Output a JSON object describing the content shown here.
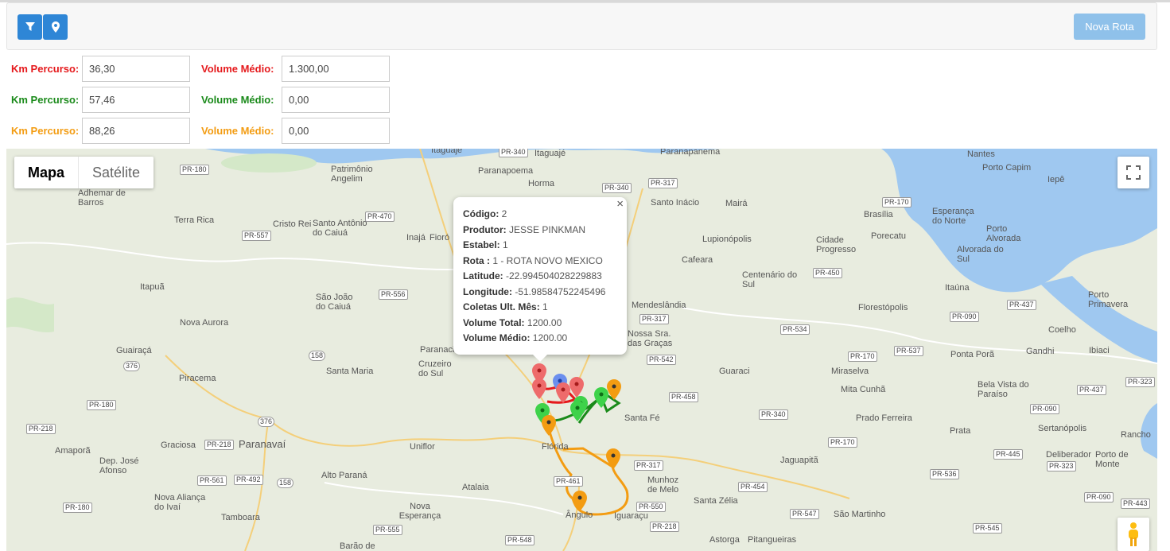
{
  "toolbar": {
    "new_route_label": "Nova Rota"
  },
  "routes": [
    {
      "km_label": "Km Percurso:",
      "km_value": "36,30",
      "vol_label": "Volume Médio:",
      "vol_value": "1.300,00",
      "color": "#e5191c"
    },
    {
      "km_label": "Km Percurso:",
      "km_value": "57,46",
      "vol_label": "Volume Médio:",
      "vol_value": "0,00",
      "color": "#1a8a1a"
    },
    {
      "km_label": "Km Percurso:",
      "km_value": "88,26",
      "vol_label": "Volume Médio:",
      "vol_value": "0,00",
      "color": "#f39c12"
    }
  ],
  "map": {
    "type_map": "Mapa",
    "type_satellite": "Satélite",
    "places": [
      {
        "t": "Itaguajé"
      },
      {
        "t": "Paranapanema"
      },
      {
        "t": "Nantes"
      },
      {
        "t": "Porto Capim"
      },
      {
        "t": "Iepê"
      },
      {
        "t": "Paranapoema"
      },
      {
        "t": "Horma"
      },
      {
        "t": "Santo Inácio"
      },
      {
        "t": "Mairá"
      },
      {
        "t": "Brasília"
      },
      {
        "t": "Esperança do Norte"
      },
      {
        "t": "Porecatu"
      },
      {
        "t": "Lupionópolis"
      },
      {
        "t": "Cidade Progresso"
      },
      {
        "t": "Porto Alvorada"
      },
      {
        "t": "Alvorada do Sul"
      },
      {
        "t": "Patrimônio Angelim"
      },
      {
        "t": "Adhemar de Barros"
      },
      {
        "t": "Terra Rica"
      },
      {
        "t": "Cristo Rei"
      },
      {
        "t": "Santo Antônio do Caiuá"
      },
      {
        "t": "Inajá"
      },
      {
        "t": "Fioró"
      },
      {
        "t": "Cafeara"
      },
      {
        "t": "Centenário do Sul"
      },
      {
        "t": "Itapuã"
      },
      {
        "t": "São João do Caiuá"
      },
      {
        "t": "Mendeslândia"
      },
      {
        "t": "Florestópolis"
      },
      {
        "t": "Itaúna"
      },
      {
        "t": "Porto Primavera"
      },
      {
        "t": "Nova Aurora"
      },
      {
        "t": "Nossa Sra. das Graças"
      },
      {
        "t": "Coelho"
      },
      {
        "t": "Guairaçá"
      },
      {
        "t": "Paranacity"
      },
      {
        "t": "Cruzeiro do Sul"
      },
      {
        "t": "Ponta Porã"
      },
      {
        "t": "Gandhi"
      },
      {
        "t": "Ibiaci"
      },
      {
        "t": "Santa Maria"
      },
      {
        "t": "Guaraci"
      },
      {
        "t": "Miraselva"
      },
      {
        "t": "Piracema"
      },
      {
        "t": "Mita Cunhã"
      },
      {
        "t": "Bela Vista do Paraíso"
      },
      {
        "t": "Santa Fé"
      },
      {
        "t": "Prado Ferreira"
      },
      {
        "t": "Paranavaí"
      },
      {
        "t": "Graciosa"
      },
      {
        "t": "Amaporã"
      },
      {
        "t": "Uniflor"
      },
      {
        "t": "Flórida"
      },
      {
        "t": "Prata"
      },
      {
        "t": "Sertanópolis"
      },
      {
        "t": "Dep. José Afonso"
      },
      {
        "t": "Alto Paraná"
      },
      {
        "t": "Jaguapitã"
      },
      {
        "t": "Deliberador"
      },
      {
        "t": "Porto de Monte"
      },
      {
        "t": "Atalaia"
      },
      {
        "t": "Munhoz de Melo"
      },
      {
        "t": "Nova Aliança do Ivaí"
      },
      {
        "t": "Santa Zélia"
      },
      {
        "t": "Tamboara"
      },
      {
        "t": "Nova Esperança"
      },
      {
        "t": "Ângulo"
      },
      {
        "t": "Iguaraçu"
      },
      {
        "t": "São Martinho"
      },
      {
        "t": "Astorga"
      },
      {
        "t": "Pitangueiras"
      },
      {
        "t": "Barão de"
      },
      {
        "t": "Rancho"
      }
    ],
    "roads": [
      "PR-340",
      "PR-180",
      "PR-557",
      "PR-470",
      "PR-340",
      "PR-317",
      "PR-170",
      "PR-556",
      "PR-450",
      "PR-437",
      "PR-090",
      "PR-317",
      "PR-534",
      "PR-537",
      "PR-542",
      "PR-170",
      "376",
      "158",
      "PR-458",
      "PR-340",
      "PR-437",
      "PR-323",
      "PR-180",
      "376",
      "PR-218",
      "PR-218",
      "PR-090",
      "PR-170",
      "PR-561",
      "PR-492",
      "158",
      "PR-317",
      "PR-461",
      "PR-454",
      "PR-536",
      "PR-445",
      "PR-323",
      "PR-550",
      "PR-090",
      "PR-180",
      "PR-547",
      "PR-443",
      "PR-218",
      "PR-555",
      "PR-545",
      "PR-548"
    ],
    "info": {
      "codigo_label": "Código:",
      "codigo": "2",
      "produtor_label": "Produtor:",
      "produtor": "JESSE PINKMAN",
      "estabel_label": "Estabel:",
      "estabel": "1",
      "rota_label": "Rota :",
      "rota": "1 - ROTA NOVO MEXICO",
      "lat_label": "Latitude:",
      "lat": "-22.994504028229883",
      "lon_label": "Longitude:",
      "lon": "-51.98584752245496",
      "coletas_label": "Coletas Ult. Mês:",
      "coletas": "1",
      "vol_total_label": "Volume Total:",
      "vol_total": "1200.00",
      "vol_medio_label": "Volume Médio:",
      "vol_medio": "1200.00",
      "close": "×"
    }
  }
}
